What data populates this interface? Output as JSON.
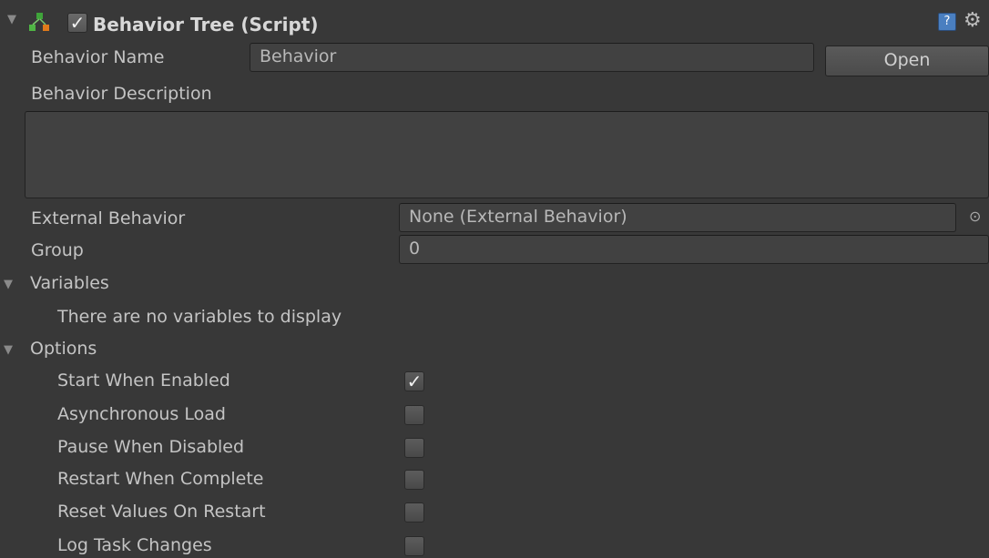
{
  "component": {
    "title": "Behavior Tree (Script)",
    "enabled": true,
    "icon": "behavior-tree-icon",
    "help_icon": "help-icon",
    "settings_icon": "gear-icon"
  },
  "behavior_name": {
    "label": "Behavior Name",
    "value": "Behavior",
    "open_button": "Open"
  },
  "behavior_description": {
    "label": "Behavior Description",
    "value": ""
  },
  "external_behavior": {
    "label": "External Behavior",
    "value": "None (External Behavior)",
    "picker_icon": "object-picker-icon"
  },
  "group": {
    "label": "Group",
    "value": "0"
  },
  "variables": {
    "label": "Variables",
    "empty_text": "There are no variables to display"
  },
  "options": {
    "label": "Options",
    "items": [
      {
        "label": "Start When Enabled",
        "checked": true
      },
      {
        "label": "Asynchronous Load",
        "checked": false
      },
      {
        "label": "Pause When Disabled",
        "checked": false
      },
      {
        "label": "Restart When Complete",
        "checked": false
      },
      {
        "label": "Reset Values On Restart",
        "checked": false
      },
      {
        "label": "Log Task Changes",
        "checked": false
      }
    ]
  },
  "colors": {
    "background": "#383838",
    "field": "#414141",
    "text": "#c4c4c4"
  }
}
